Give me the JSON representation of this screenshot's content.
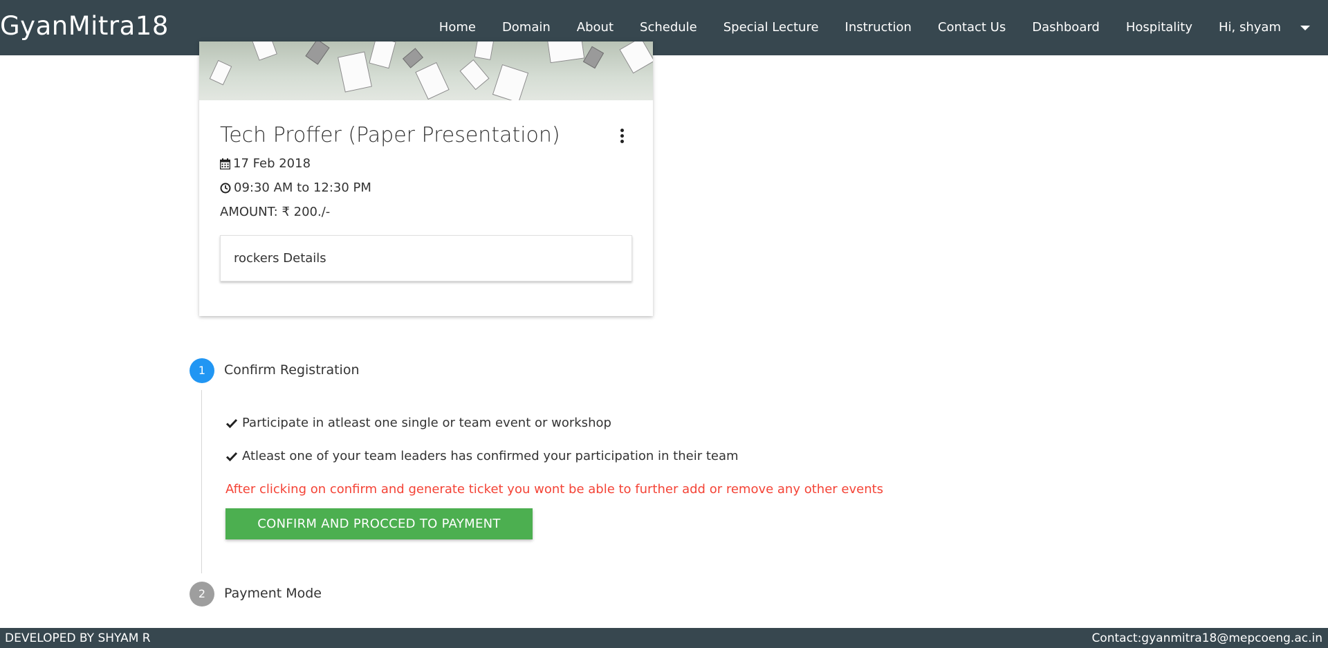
{
  "brand": "GyanMitra18",
  "nav": {
    "items": [
      "Home",
      "Domain",
      "About",
      "Schedule",
      "Special Lecture",
      "Instruction",
      "Contact Us",
      "Dashboard",
      "Hospitality"
    ],
    "user": "Hi, shyam"
  },
  "event": {
    "title": "Tech Proffer (Paper Presentation)",
    "date": "17 Feb 2018",
    "time": "09:30 AM to 12:30 PM",
    "amount": "AMOUNT: ₹ 200./-",
    "details_label": "rockers Details"
  },
  "steps": [
    {
      "number": "1",
      "label": "Confirm Registration",
      "color": "#2196f3"
    },
    {
      "number": "2",
      "label": "Payment Mode",
      "color": "#9e9e9e"
    }
  ],
  "requirements": [
    "Participate in atleast one single or team event or workshop",
    "Atleast one of your team leaders has confirmed your participation in their team"
  ],
  "warning": "After clicking on confirm and generate ticket you wont be able to further add or remove any other events",
  "confirm_button": "CONFIRM AND PROCCED TO PAYMENT",
  "footer": {
    "left": "DEVELOPED BY SHYAM R",
    "right": "Contact:gyanmitra18@mepcoeng.ac.in"
  },
  "colors": {
    "navbar": "#37474f",
    "accent_blue": "#2196f3",
    "button_green": "#4caf50",
    "warning_red": "#f44336"
  }
}
